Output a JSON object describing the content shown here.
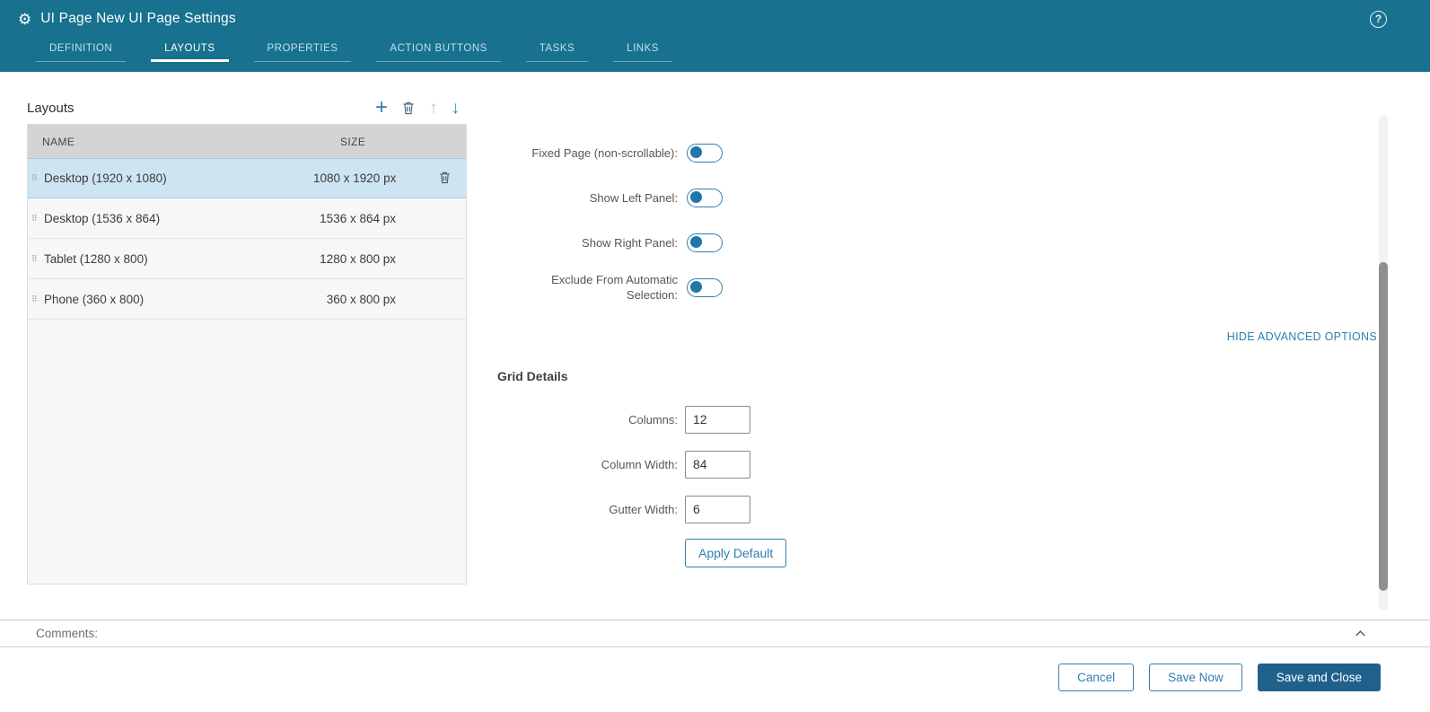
{
  "colors": {
    "header_bg": "#17718f",
    "accent": "#2e7faf",
    "primary_button_bg": "#20618c",
    "selected_row_bg": "#cde4f3"
  },
  "icons": {
    "gear": "⚙",
    "help": "?",
    "plus": "+",
    "up": "↑",
    "down": "↓",
    "drag": "⠿"
  },
  "header": {
    "title": "UI Page New UI Page Settings",
    "active_tab": "LAYOUTS",
    "tabs": [
      {
        "label": "DEFINITION"
      },
      {
        "label": "LAYOUTS"
      },
      {
        "label": "PROPERTIES"
      },
      {
        "label": "ACTION BUTTONS"
      },
      {
        "label": "TASKS"
      },
      {
        "label": "LINKS"
      }
    ]
  },
  "layouts_panel": {
    "title": "Layouts",
    "columns": [
      "NAME",
      "SIZE"
    ],
    "rows": [
      {
        "name": "Desktop (1920 x 1080)",
        "size": "1080 x 1920 px",
        "selected": true
      },
      {
        "name": "Desktop (1536 x 864)",
        "size": "1536 x 864 px",
        "selected": false
      },
      {
        "name": "Tablet (1280 x 800)",
        "size": "1280 x 800 px",
        "selected": false
      },
      {
        "name": "Phone (360 x 800)",
        "size": "360 x 800 px",
        "selected": false
      }
    ]
  },
  "form": {
    "toggles": [
      {
        "label": "Fixed Page (non-scrollable):",
        "state": "off"
      },
      {
        "label": "Show Left Panel:",
        "state": "off"
      },
      {
        "label": "Show Right Panel:",
        "state": "off"
      },
      {
        "label": "Exclude From Automatic Selection:",
        "state": "off"
      }
    ],
    "advanced_options_link": "HIDE ADVANCED OPTIONS",
    "grid_details": {
      "title": "Grid Details",
      "fields": [
        {
          "label": "Columns:",
          "value": "12"
        },
        {
          "label": "Column Width:",
          "value": "84"
        },
        {
          "label": "Gutter Width:",
          "value": "6"
        }
      ],
      "apply_button_label": "Apply Default"
    }
  },
  "comments": {
    "label": "Comments:"
  },
  "footer": {
    "cancel_label": "Cancel",
    "save_now_label": "Save Now",
    "save_and_close_label": "Save and Close"
  }
}
